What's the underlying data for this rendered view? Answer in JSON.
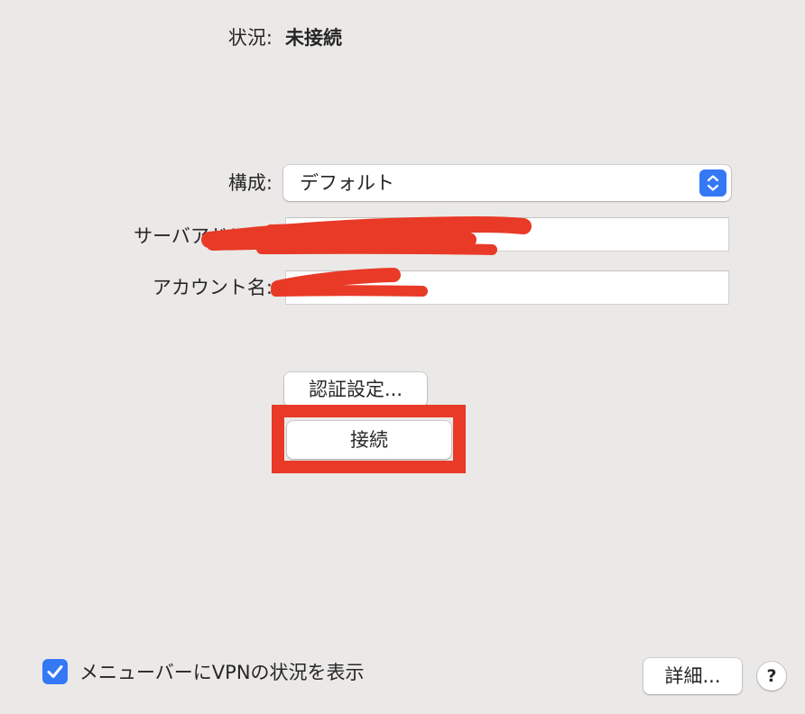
{
  "status": {
    "label": "状況:",
    "value": "未接続"
  },
  "config": {
    "label": "構成:",
    "selected": "デフォルト"
  },
  "server": {
    "label": "サーバアドレス:",
    "value": ""
  },
  "account": {
    "label": "アカウント名:",
    "value": ""
  },
  "buttons": {
    "auth_settings": "認証設定...",
    "connect": "接続",
    "advanced": "詳細...",
    "help": "?"
  },
  "menubar_status": {
    "checked": true,
    "label": "メニューバーにVPNの状況を表示"
  },
  "colors": {
    "background": "#ebe9e7",
    "accent": "#3478f6",
    "annotation": "#e83a27"
  }
}
